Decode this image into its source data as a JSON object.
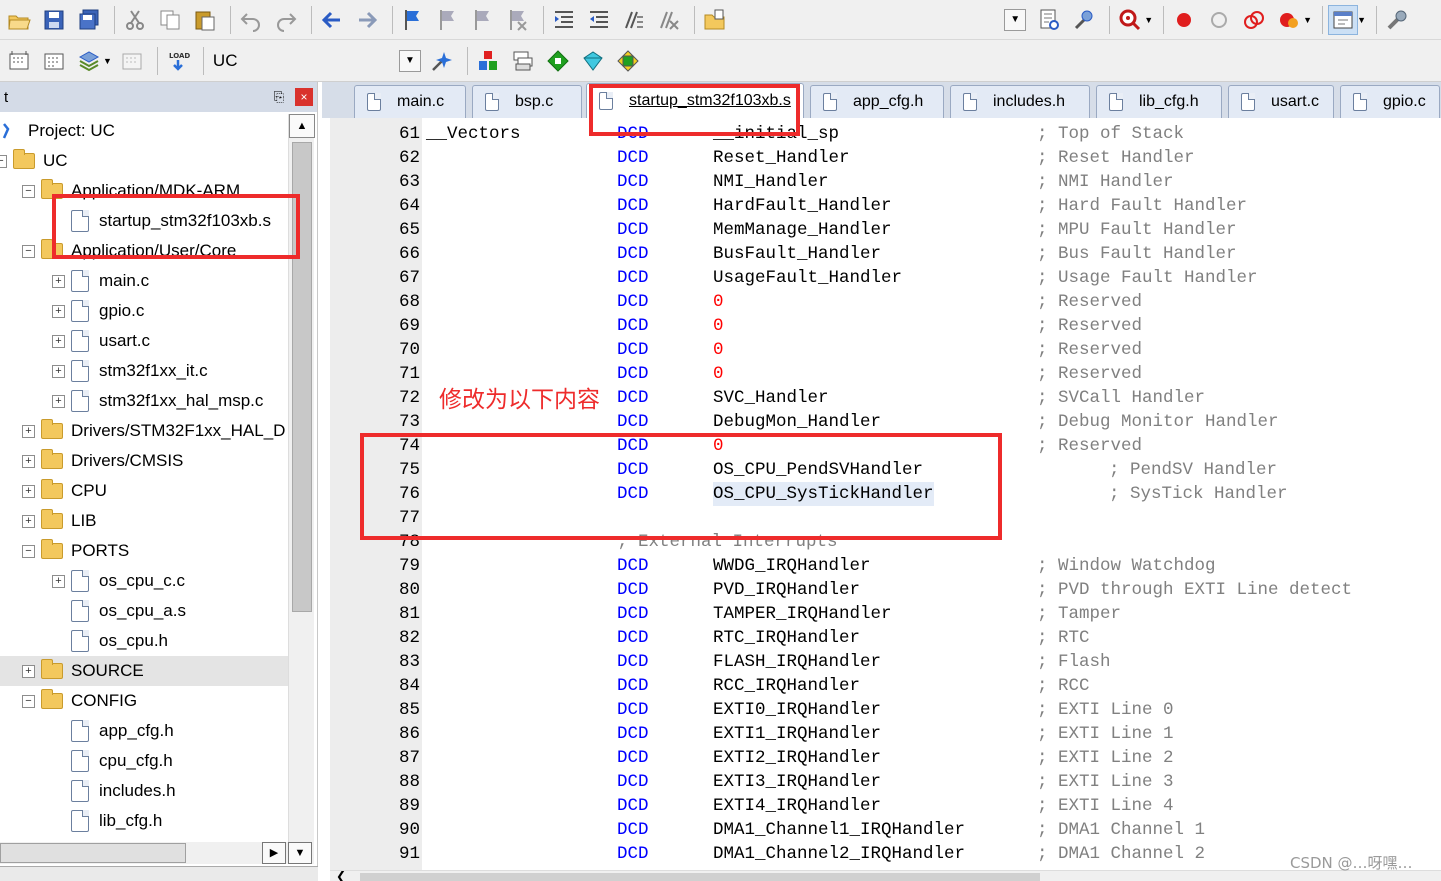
{
  "toolbar": {
    "target_name": "UC"
  },
  "sidebar": {
    "title": "t",
    "pin_icon": "pin-icon",
    "close_label": "×",
    "tree": [
      {
        "label": "Project: UC",
        "level": 0,
        "type": "project",
        "expander": ""
      },
      {
        "label": "UC",
        "level": 0,
        "type": "folder",
        "expander": "-"
      },
      {
        "label": "Application/MDK-ARM",
        "level": 1,
        "type": "folder",
        "expander": "-"
      },
      {
        "label": "startup_stm32f103xb.s",
        "level": 2,
        "type": "file",
        "expander": ""
      },
      {
        "label": "Application/User/Core",
        "level": 1,
        "type": "folder",
        "expander": "-"
      },
      {
        "label": "main.c",
        "level": 2,
        "type": "file",
        "expander": "+"
      },
      {
        "label": "gpio.c",
        "level": 2,
        "type": "file",
        "expander": "+"
      },
      {
        "label": "usart.c",
        "level": 2,
        "type": "file",
        "expander": "+"
      },
      {
        "label": "stm32f1xx_it.c",
        "level": 2,
        "type": "file",
        "expander": "+"
      },
      {
        "label": "stm32f1xx_hal_msp.c",
        "level": 2,
        "type": "file",
        "expander": "+"
      },
      {
        "label": "Drivers/STM32F1xx_HAL_D",
        "level": 1,
        "type": "folder",
        "expander": "+"
      },
      {
        "label": "Drivers/CMSIS",
        "level": 1,
        "type": "folder",
        "expander": "+"
      },
      {
        "label": "CPU",
        "level": 1,
        "type": "folder",
        "expander": "+"
      },
      {
        "label": "LIB",
        "level": 1,
        "type": "folder",
        "expander": "+"
      },
      {
        "label": "PORTS",
        "level": 1,
        "type": "folder",
        "expander": "-"
      },
      {
        "label": "os_cpu_c.c",
        "level": 2,
        "type": "file",
        "expander": "+"
      },
      {
        "label": "os_cpu_a.s",
        "level": 2,
        "type": "file",
        "expander": ""
      },
      {
        "label": "os_cpu.h",
        "level": 2,
        "type": "file",
        "expander": ""
      },
      {
        "label": "SOURCE",
        "level": 1,
        "type": "folder",
        "expander": "+",
        "selected": true
      },
      {
        "label": "CONFIG",
        "level": 1,
        "type": "folder",
        "expander": "-"
      },
      {
        "label": "app_cfg.h",
        "level": 2,
        "type": "file",
        "expander": ""
      },
      {
        "label": "cpu_cfg.h",
        "level": 2,
        "type": "file",
        "expander": ""
      },
      {
        "label": "includes.h",
        "level": 2,
        "type": "file",
        "expander": ""
      },
      {
        "label": "lib_cfg.h",
        "level": 2,
        "type": "file",
        "expander": ""
      }
    ]
  },
  "tabs": [
    {
      "label": "main.c",
      "active": false
    },
    {
      "label": "bsp.c",
      "active": false
    },
    {
      "label": "startup_stm32f103xb.s",
      "active": true
    },
    {
      "label": "app_cfg.h",
      "active": false
    },
    {
      "label": "includes.h",
      "active": false
    },
    {
      "label": "lib_cfg.h",
      "active": false
    },
    {
      "label": "usart.c",
      "active": false
    },
    {
      "label": "gpio.c",
      "active": false
    }
  ],
  "code": [
    {
      "n": "61",
      "label": "__Vectors",
      "op": "DCD",
      "arg": "__initial_sp",
      "comment": "; Top of Stack"
    },
    {
      "n": "62",
      "label": "",
      "op": "DCD",
      "arg": "Reset_Handler",
      "comment": "; Reset Handler"
    },
    {
      "n": "63",
      "label": "",
      "op": "DCD",
      "arg": "NMI_Handler",
      "comment": "; NMI Handler"
    },
    {
      "n": "64",
      "label": "",
      "op": "DCD",
      "arg": "HardFault_Handler",
      "comment": "; Hard Fault Handler"
    },
    {
      "n": "65",
      "label": "",
      "op": "DCD",
      "arg": "MemManage_Handler",
      "comment": "; MPU Fault Handler"
    },
    {
      "n": "66",
      "label": "",
      "op": "DCD",
      "arg": "BusFault_Handler",
      "comment": "; Bus Fault Handler"
    },
    {
      "n": "67",
      "label": "",
      "op": "DCD",
      "arg": "UsageFault_Handler",
      "comment": "; Usage Fault Handler"
    },
    {
      "n": "68",
      "label": "",
      "op": "DCD",
      "arg": "0",
      "comment": "; Reserved"
    },
    {
      "n": "69",
      "label": "",
      "op": "DCD",
      "arg": "0",
      "comment": "; Reserved"
    },
    {
      "n": "70",
      "label": "",
      "op": "DCD",
      "arg": "0",
      "comment": "; Reserved"
    },
    {
      "n": "71",
      "label": "",
      "op": "DCD",
      "arg": "0",
      "comment": "; Reserved"
    },
    {
      "n": "72",
      "label": "",
      "op": "DCD",
      "arg": "SVC_Handler",
      "comment": "; SVCall Handler"
    },
    {
      "n": "73",
      "label": "",
      "op": "DCD",
      "arg": "DebugMon_Handler",
      "comment": "; Debug Monitor Handler"
    },
    {
      "n": "74",
      "label": "",
      "op": "DCD",
      "arg": "0",
      "comment": "; Reserved"
    },
    {
      "n": "75",
      "label": "",
      "op": "DCD",
      "arg": "OS_CPU_PendSVHandler",
      "comment": "; PendSV Handler",
      "indent_comment": true
    },
    {
      "n": "76",
      "label": "",
      "op": "DCD",
      "arg": "OS_CPU_SysTickHandler",
      "comment": "; SysTick Handler",
      "indent_comment": true,
      "highlight": true
    },
    {
      "n": "77",
      "label": "",
      "op": "",
      "arg": "",
      "comment": ""
    },
    {
      "n": "78",
      "label": "",
      "op": "; External Interrupts",
      "arg": "",
      "comment": "",
      "op_is_comment": true
    },
    {
      "n": "79",
      "label": "",
      "op": "DCD",
      "arg": "WWDG_IRQHandler",
      "comment": "; Window Watchdog"
    },
    {
      "n": "80",
      "label": "",
      "op": "DCD",
      "arg": "PVD_IRQHandler",
      "comment": "; PVD through EXTI Line detect"
    },
    {
      "n": "81",
      "label": "",
      "op": "DCD",
      "arg": "TAMPER_IRQHandler",
      "comment": "; Tamper"
    },
    {
      "n": "82",
      "label": "",
      "op": "DCD",
      "arg": "RTC_IRQHandler",
      "comment": "; RTC"
    },
    {
      "n": "83",
      "label": "",
      "op": "DCD",
      "arg": "FLASH_IRQHandler",
      "comment": "; Flash"
    },
    {
      "n": "84",
      "label": "",
      "op": "DCD",
      "arg": "RCC_IRQHandler",
      "comment": "; RCC"
    },
    {
      "n": "85",
      "label": "",
      "op": "DCD",
      "arg": "EXTI0_IRQHandler",
      "comment": "; EXTI Line 0"
    },
    {
      "n": "86",
      "label": "",
      "op": "DCD",
      "arg": "EXTI1_IRQHandler",
      "comment": "; EXTI Line 1"
    },
    {
      "n": "87",
      "label": "",
      "op": "DCD",
      "arg": "EXTI2_IRQHandler",
      "comment": "; EXTI Line 2"
    },
    {
      "n": "88",
      "label": "",
      "op": "DCD",
      "arg": "EXTI3_IRQHandler",
      "comment": "; EXTI Line 3"
    },
    {
      "n": "89",
      "label": "",
      "op": "DCD",
      "arg": "EXTI4_IRQHandler",
      "comment": "; EXTI Line 4"
    },
    {
      "n": "90",
      "label": "",
      "op": "DCD",
      "arg": "DMA1_Channel1_IRQHandler",
      "comment": "; DMA1 Channel 1"
    },
    {
      "n": "91",
      "label": "",
      "op": "DCD",
      "arg": "DMA1_Channel2_IRQHandler",
      "comment": "; DMA1 Channel 2"
    }
  ],
  "annotation": {
    "text": "修改为以下内容",
    "color": "#ee2b2b"
  },
  "watermark": "CSDN @…呀嘿…"
}
